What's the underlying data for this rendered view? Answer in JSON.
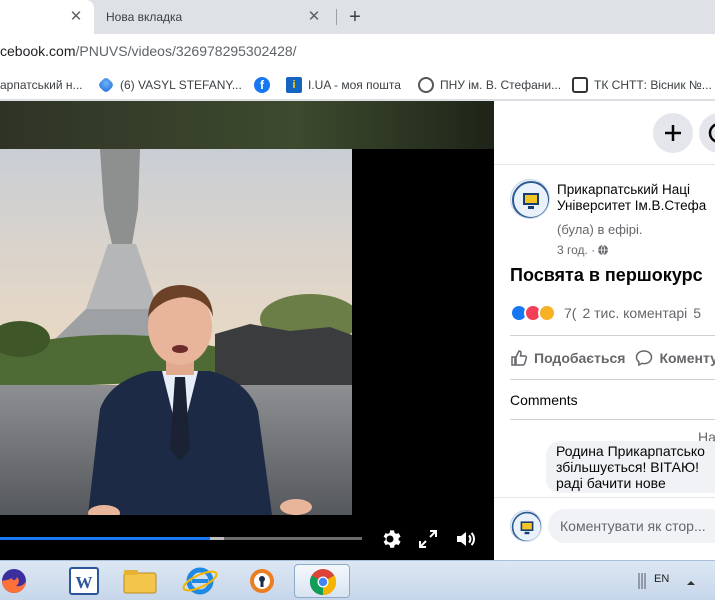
{
  "browser": {
    "tabs": [
      {
        "label": "",
        "active": true
      },
      {
        "label": "Нова вкладка",
        "active": false
      }
    ],
    "new_tab_symbol": "+",
    "close_symbol": "✕",
    "url_visible": "cebook.com/PNUVS/videos/326978295302428/",
    "url_host_part": "cebook.com",
    "url_path_part": "/PNUVS/videos/326978295302428/"
  },
  "bookmarks": [
    {
      "label": "арпатський н...",
      "icon": "page-icon"
    },
    {
      "label": "(6) VASYL STEFANY...",
      "icon": "vasyl-icon"
    },
    {
      "label": "",
      "icon": "facebook-icon"
    },
    {
      "label": "I.UA - моя пошта",
      "icon": "iua-icon"
    },
    {
      "label": "ПНУ ім. В. Стефани...",
      "icon": "pnu-icon"
    },
    {
      "label": "ТК СНТТ: Вісник №...",
      "icon": "sntt-icon"
    }
  ],
  "video": {
    "progress_fraction": 0.58,
    "buffered_fraction": 0.62,
    "controls": [
      "settings-icon",
      "fullscreen-icon",
      "volume-icon"
    ]
  },
  "panel": {
    "top_buttons": [
      "plus-icon",
      "messenger-icon"
    ],
    "page_name_line1": "Прикарпатський Наці",
    "page_name_line2": "Університет Ім.В.Стефа",
    "live_status": "(була) в ефірі.",
    "time": "3 год. ·",
    "privacy_icon": "globe-icon",
    "post_title": "Посвята в першокурс",
    "reaction_count": "7(",
    "comment_count": "2 тис. коментарі",
    "share_count": "5",
    "like_label": "Подобається",
    "comment_label": "Коменту",
    "comments_heading": "Comments",
    "comment_author_fragment": "На",
    "comment_text": "Родина Прикарпатсько збільшується! ВІТАЮ! раді бачити нове",
    "write_placeholder": "Коментувати як стор..."
  },
  "taskbar": {
    "apps": [
      "firefox-icon",
      "word-icon",
      "explorer-icon",
      "ie-icon",
      "openvpn-icon",
      "chrome-icon"
    ],
    "active_app": "chrome-icon",
    "language": "EN"
  },
  "colors": {
    "fb_blue": "#1877f2",
    "panel_bg": "#ffffff",
    "chrome_tab_bg": "#dee1e6"
  }
}
